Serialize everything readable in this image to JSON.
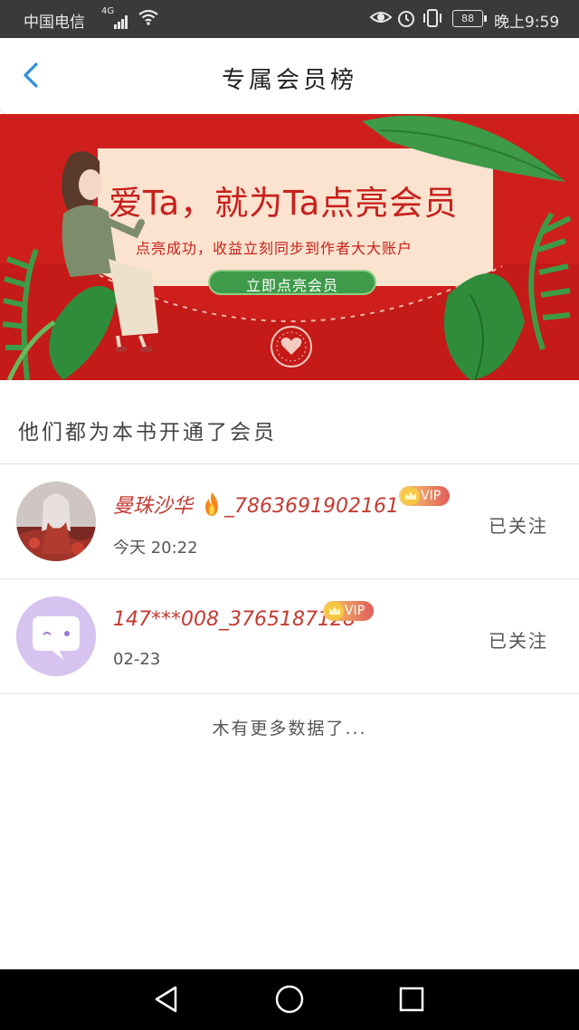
{
  "status_bar": {
    "carrier": "中国电信",
    "network": "4G",
    "battery": "88",
    "time": "晚上9:59"
  },
  "nav": {
    "title": "专属会员榜"
  },
  "banner": {
    "headline": "爱Ta，就为Ta点亮会员",
    "subline": "点亮成功，收益立刻同步到作者大大账户",
    "button": "立即点亮会员",
    "colors": {
      "background": "#cf1f1c",
      "card": "#fbe3cf",
      "button": "#3f9a4a",
      "headline": "#c8201c"
    }
  },
  "section": {
    "title": "他们都为本书开通了会员"
  },
  "members": [
    {
      "name": "曼珠沙华",
      "name_suffix": "_7863691902161",
      "vip": "VIP",
      "date": "今天 20:22",
      "action": "已关注"
    },
    {
      "name": "147***008_3765187128",
      "name_suffix": "",
      "vip": "VIP",
      "date": "02-23",
      "action": "已关注"
    }
  ],
  "footer": {
    "no_more": "木有更多数据了..."
  },
  "icons": [
    "back-icon",
    "fire-icon",
    "crown-icon",
    "wifi-icon",
    "nav-back-icon",
    "nav-home-icon",
    "nav-recents-icon"
  ]
}
